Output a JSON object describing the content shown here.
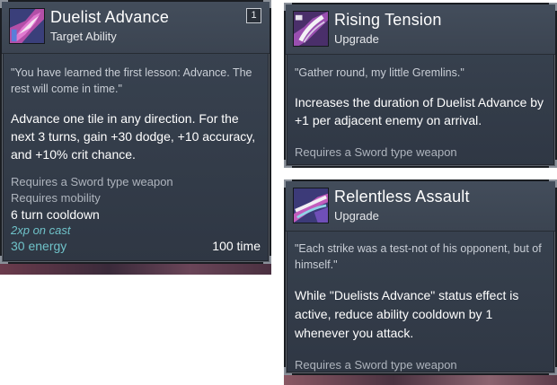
{
  "cards": [
    {
      "title": "Duelist Advance",
      "type": "Target Ability",
      "hotkey": "1",
      "icon": "duelist-advance-icon",
      "quote": "\"You have learned the first lesson: Advance. The rest will come in time.\"",
      "description": "Advance one tile in any direction. For the next 3 turns, gain +30 dodge, +10 accuracy, and +10% crit chance.",
      "requirements": [
        "Requires a Sword type weapon",
        "Requires mobility"
      ],
      "cooldown": "6 turn cooldown",
      "xp": "2xp on cast",
      "energy": "30 energy",
      "time": "100 time"
    },
    {
      "title": "Rising Tension",
      "type": "Upgrade",
      "icon": "rising-tension-icon",
      "quote": "\"Gather round, my little Gremlins.\"",
      "description": "Increases the duration of Duelist Advance by +1 per adjacent enemy on arrival.",
      "requirement": "Requires a Sword type weapon"
    },
    {
      "title": "Relentless Assault",
      "type": "Upgrade",
      "icon": "relentless-assault-icon",
      "quote": "\"Each strike was a test-not of his opponent, but of himself.\"",
      "description": "While \"Duelists Advance\" status effect is active, reduce ability cooldown by 1 whenever you attack.",
      "requirement": "Requires a Sword type weapon"
    }
  ],
  "colors": {
    "panel": "#343d4a",
    "accent_cyan": "#6fc2c9",
    "muted_text": "#aeb4bd",
    "quote_text": "#c9ced6"
  }
}
